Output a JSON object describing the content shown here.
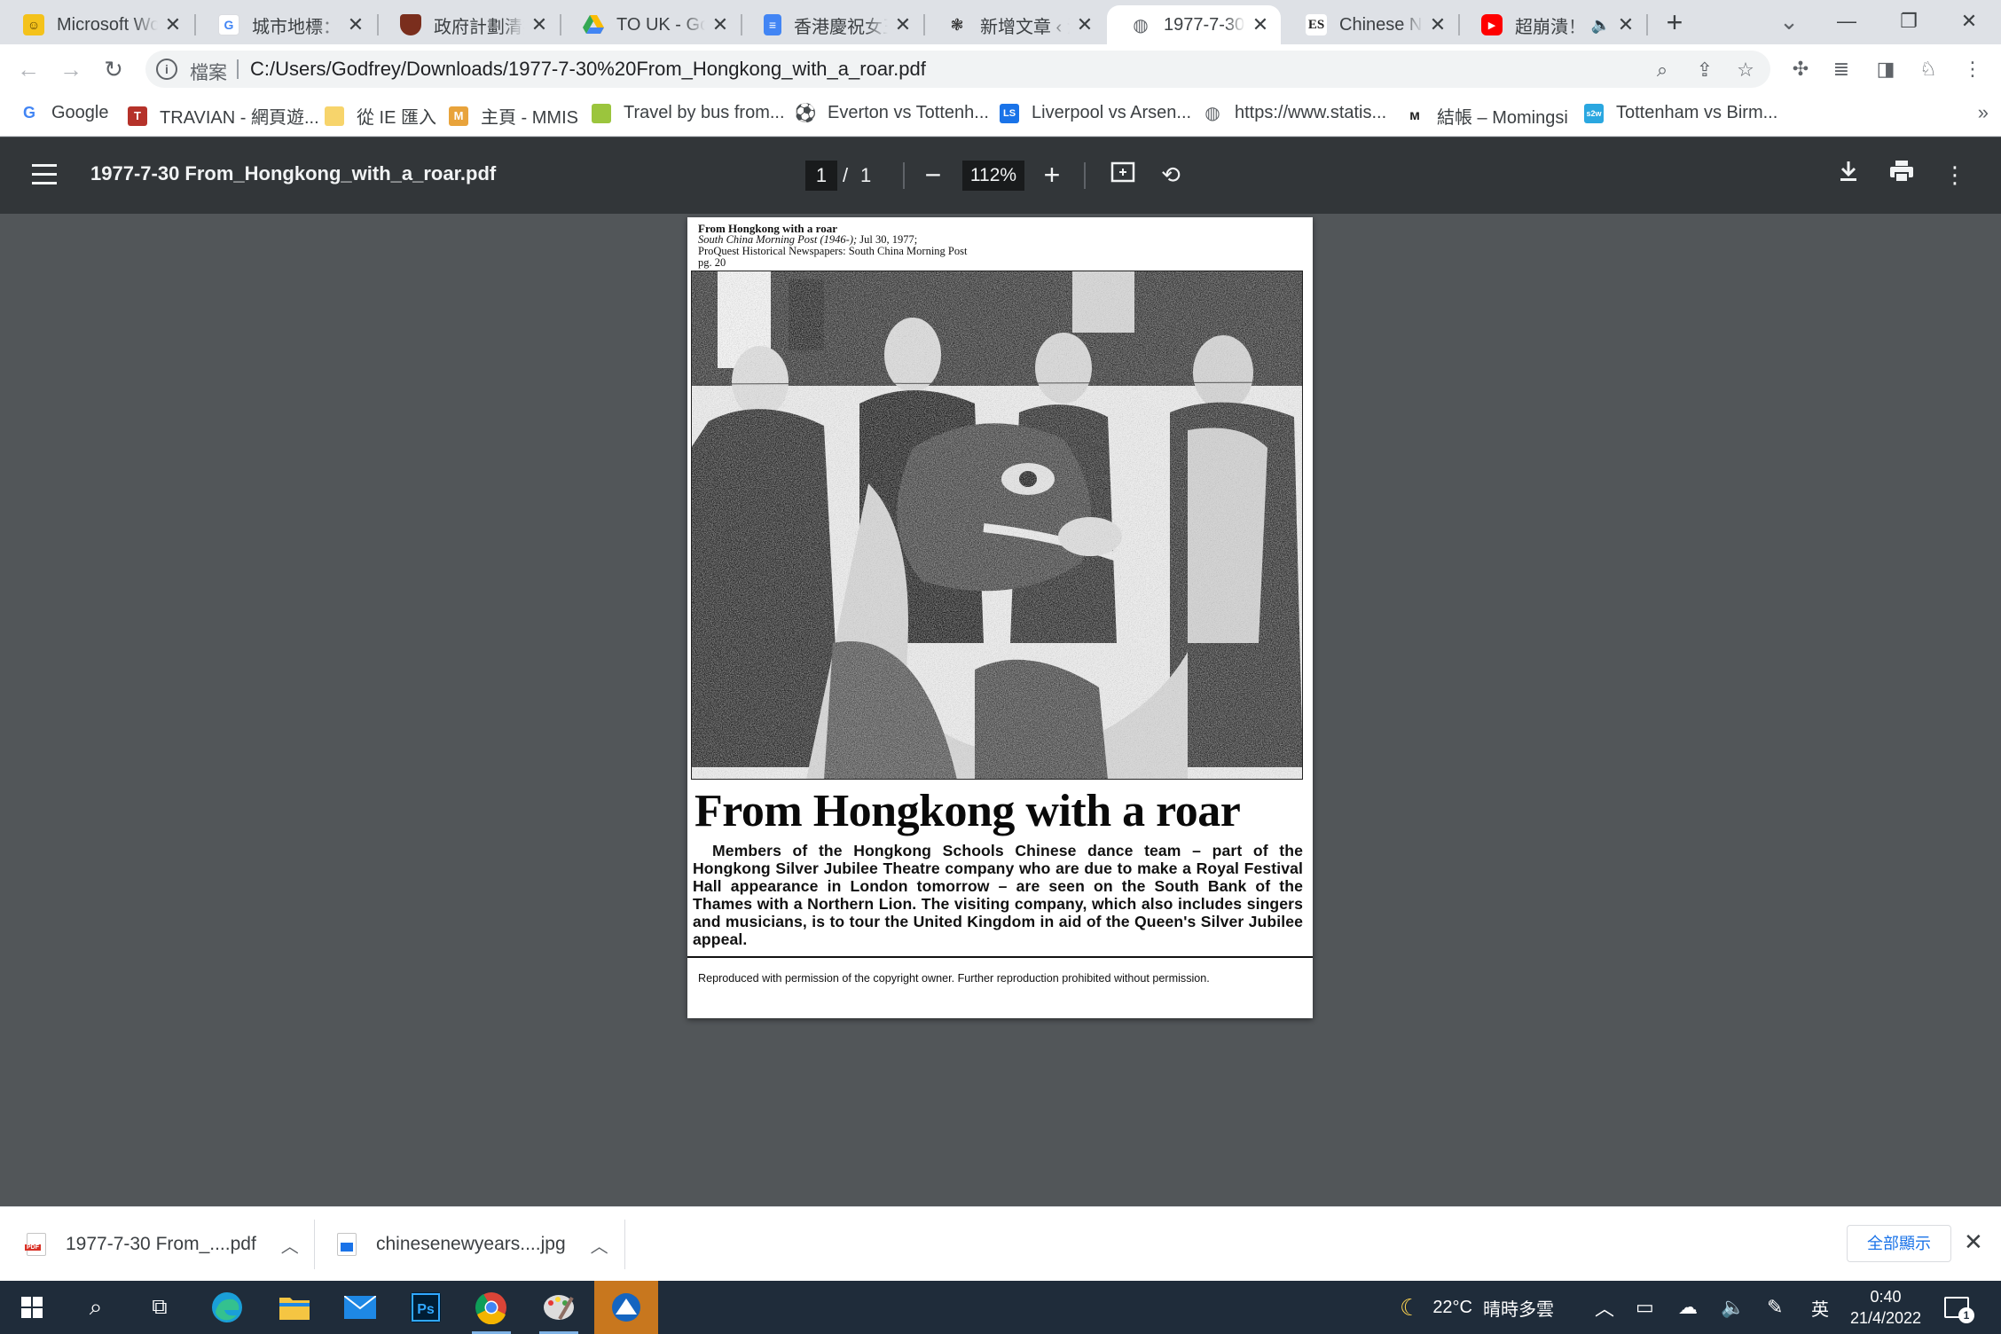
{
  "browser": {
    "tabs": [
      {
        "title": "Microsoft Word",
        "favicon": "word-emoji-icon",
        "color": "#f4c21b"
      },
      {
        "title": "城市地標：殖民地建築",
        "favicon": "google-g-icon",
        "color": "#4285f4"
      },
      {
        "title": "政府計劃清拆",
        "favicon": "shield-icon",
        "color": "#7a2e1d"
      },
      {
        "title": "TO UK - Google Drive",
        "favicon": "drive-icon",
        "color": "#34a853"
      },
      {
        "title": "香港慶祝女王",
        "favicon": "docs-icon",
        "color": "#4285f4"
      },
      {
        "title": "新增文章 ‹ 港",
        "favicon": "wordpress-icon",
        "color": "#333333"
      },
      {
        "title": "1977-7-30 From_Hongkong_with_a_roar.pdf",
        "favicon": "globe-icon",
        "color": "#5f6368"
      },
      {
        "title": "Chinese New Year",
        "favicon": "es-icon",
        "color": "#222222"
      },
      {
        "title": "超崩潰！",
        "favicon": "youtube-icon",
        "color": "#ff0000"
      }
    ],
    "new_tab": "+",
    "window_controls": {
      "minimize": "—",
      "restore": "❐",
      "close": "✕"
    },
    "omnibox": {
      "chip": "檔案",
      "url": "C:/Users/Godfrey/Downloads/1977-7-30%20From_Hongkong_with_a_roar.pdf"
    },
    "bookmarks": [
      {
        "label": "Google",
        "icon": "google-g-icon",
        "color": "#4285f4"
      },
      {
        "label": "TRAVIAN - 網頁遊...",
        "icon": "travian-icon",
        "color": "#b5322a"
      },
      {
        "label": "從 IE 匯入",
        "icon": "folder-icon",
        "color": "#f7d46b"
      },
      {
        "label": "主頁 - MMIS",
        "icon": "mmis-icon",
        "color": "#e8a33b"
      },
      {
        "label": "Travel by bus from...",
        "icon": "bus-icon",
        "color": "#9bc53d"
      },
      {
        "label": "Everton vs Tottenh...",
        "icon": "football-icon",
        "color": "#333333"
      },
      {
        "label": "Liverpool vs Arsen...",
        "icon": "livescore-icon",
        "color": "#1a73e8"
      },
      {
        "label": "https://www.statis...",
        "icon": "globe-icon",
        "color": "#5f6368"
      },
      {
        "label": "結帳 – Momingsi",
        "icon": "momingsi-icon",
        "color": "#222222"
      },
      {
        "label": "Tottenham vs Birm...",
        "icon": "s2w-icon",
        "color": "#2aa7e0"
      }
    ],
    "bookmarks_more": "»"
  },
  "pdf_viewer": {
    "file_title": "1977-7-30 From_Hongkong_with_a_roar.pdf",
    "current_page": "1",
    "page_separator": "/",
    "total_pages": "1",
    "zoom": "112%",
    "zoom_out": "−",
    "zoom_in": "+"
  },
  "document": {
    "citation_title": "From Hongkong with a roar",
    "citation_source": "South China Morning Post (1946-);",
    "citation_date": " Jul 30, 1977;",
    "citation_db": "ProQuest Historical Newspapers: South China Morning Post",
    "citation_page": "pg. 20",
    "headline": "From Hongkong  with a roar",
    "caption": "Members of the Hongkong Schools Chinese dance team – part of the Hongkong Silver Jubilee Theatre company who are due to make a Royal Festival Hall appearance in London tomorrow – are seen on the South Bank of the Thames with a Northern Lion. The visiting company, which also includes singers and musicians, is to tour the United Kingdom in aid of the Queen's Silver Jubilee appeal.",
    "footer": "Reproduced with permission of the copyright owner.  Further reproduction prohibited without permission."
  },
  "downloads": {
    "items": [
      {
        "name": "1977-7-30 From_....pdf",
        "type": "pdf"
      },
      {
        "name": "chinesenewyears....jpg",
        "type": "jpg"
      }
    ],
    "show_all": "全部顯示",
    "close": "✕"
  },
  "taskbar": {
    "apps": [
      "windows-start-icon",
      "search-icon",
      "task-view-icon",
      "edge-icon",
      "file-explorer-icon",
      "mail-icon",
      "photoshop-icon",
      "chrome-icon",
      "paint-icon",
      "unknown-app-icon"
    ],
    "weather": {
      "temp": "22°C",
      "desc": "晴時多雲"
    },
    "ime": "英",
    "time": "0:40",
    "date": "21/4/2022",
    "notifications": "1"
  }
}
